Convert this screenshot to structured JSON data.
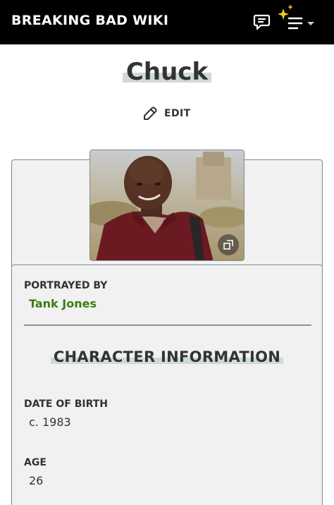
{
  "header": {
    "site_title": "BREAKING BAD WIKI",
    "icons": [
      "discuss-icon",
      "sparkle-icon",
      "menu-icon",
      "chevron-down-icon"
    ]
  },
  "page": {
    "title": "Chuck",
    "edit_label": "EDIT"
  },
  "infobox": {
    "image": {
      "icons": [
        "expand-icon"
      ]
    },
    "portrayed_by": {
      "label": "PORTRAYED BY",
      "value": "Tank Jones"
    },
    "section_title": "CHARACTER INFORMATION",
    "fields": [
      {
        "label": "DATE OF BIRTH",
        "value": "c. 1983"
      },
      {
        "label": "AGE",
        "value": "26"
      }
    ]
  },
  "colors": {
    "header_bg": "#000000",
    "link": "#3a7d12",
    "highlight": "#cfdad5",
    "infobox_bg": "#f1f1f1",
    "sparkle": "#f5c518"
  }
}
